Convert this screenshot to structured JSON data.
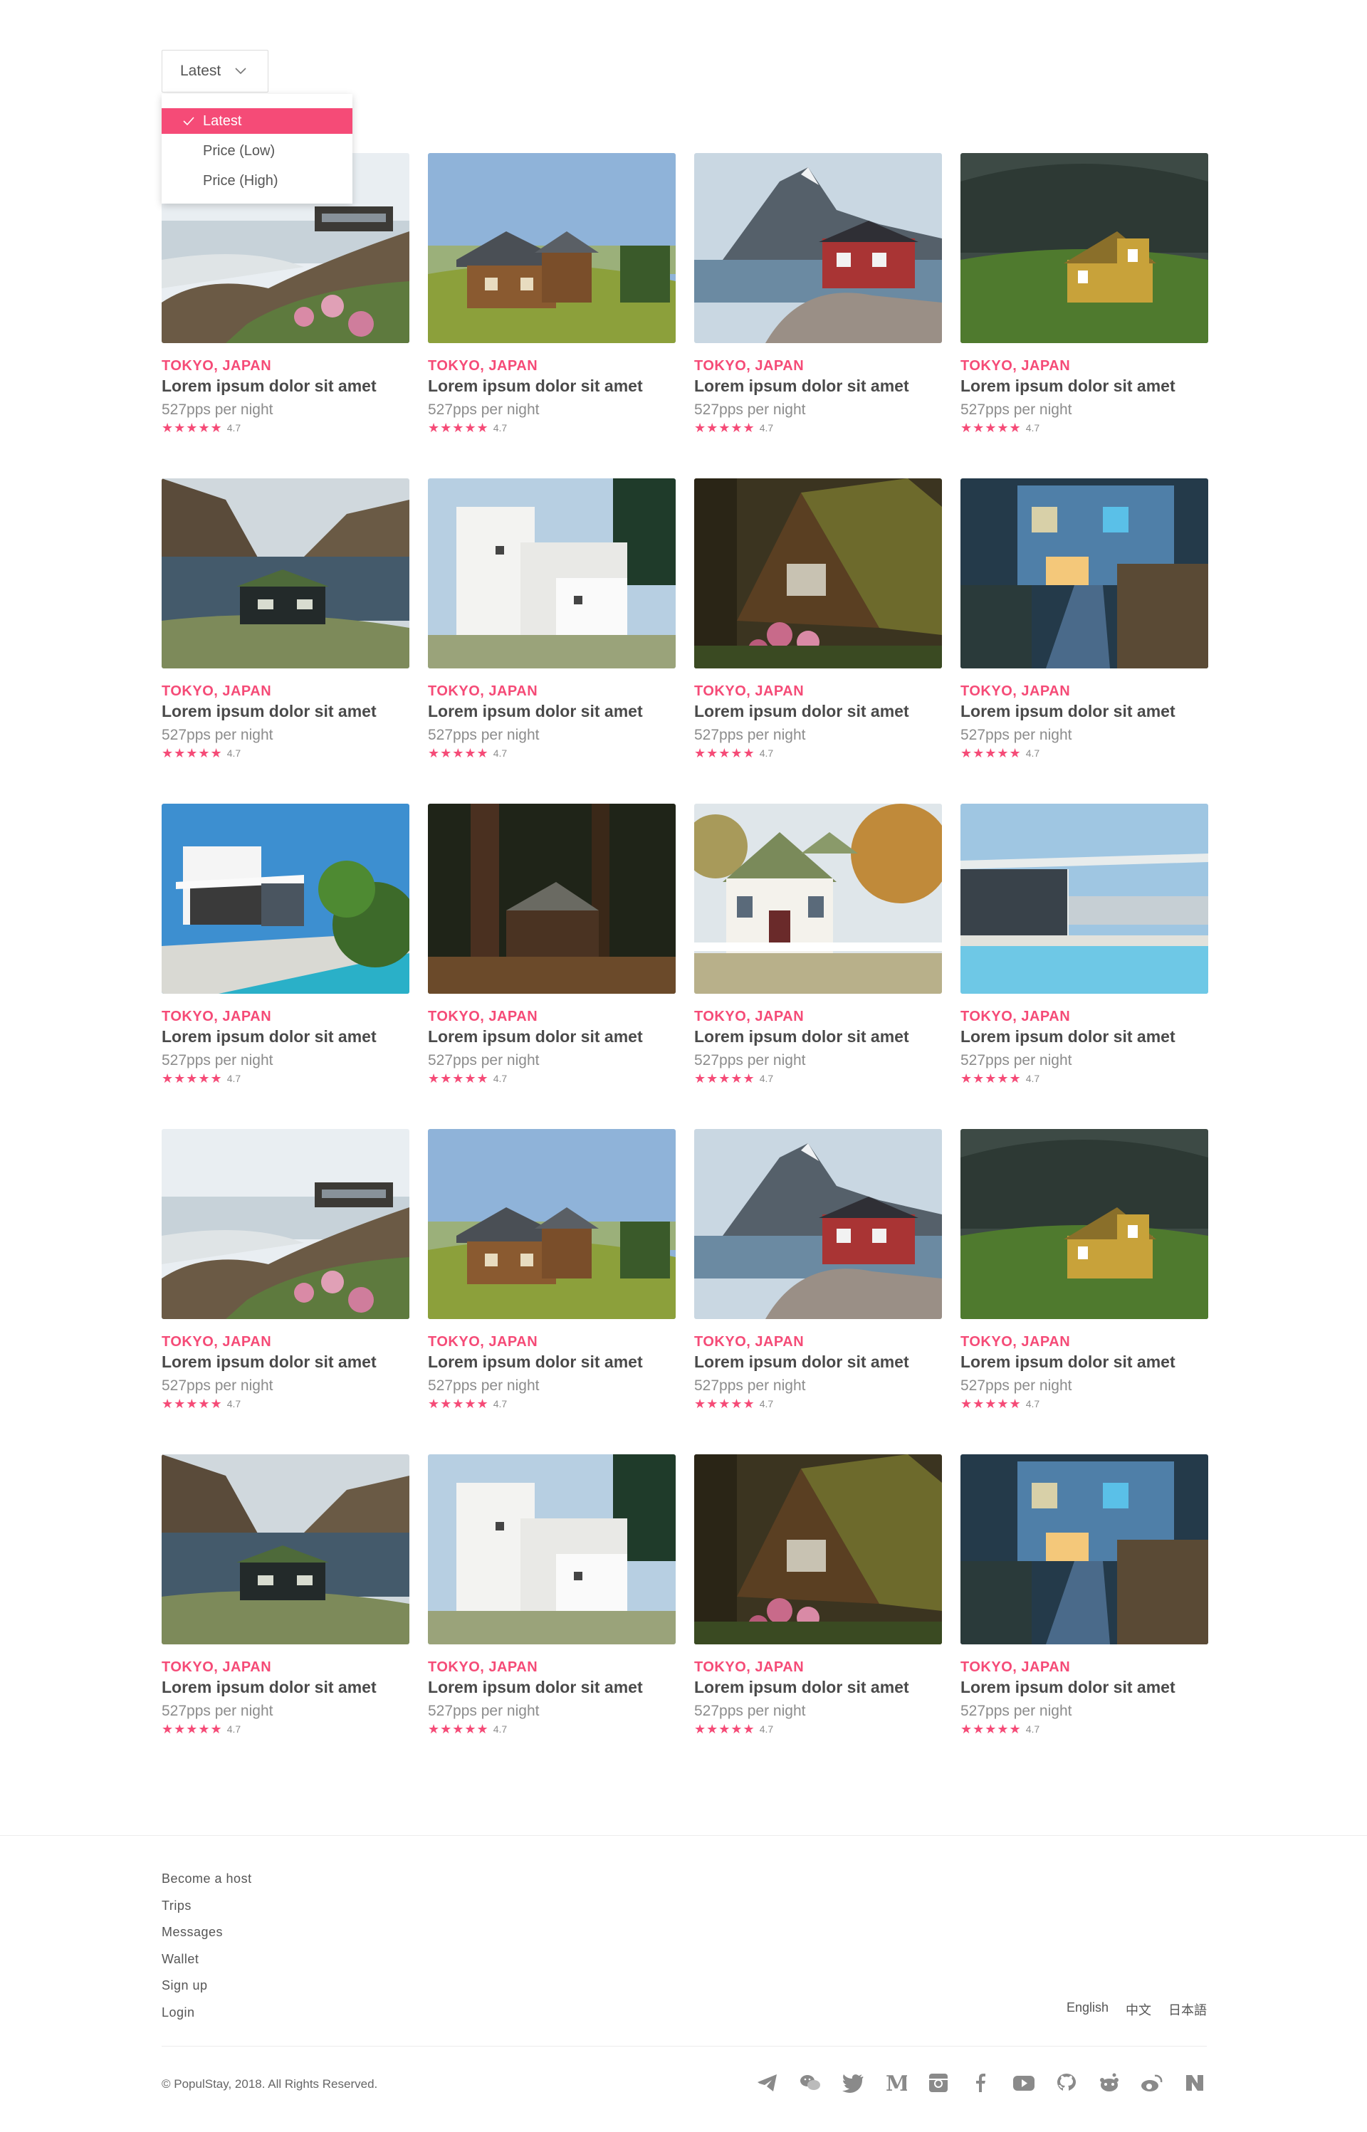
{
  "sort": {
    "current_label": "Latest",
    "options": [
      "Latest",
      "Price (Low)",
      "Price (High)"
    ],
    "selected_index": 0
  },
  "colors": {
    "accent": "#f54b77",
    "text": "#4a4a4a",
    "muted": "#8c8c8c"
  },
  "listings": [
    {
      "location": "TOKYO, JAPAN",
      "title": "Lorem ipsum dolor sit amet",
      "price": "527pps per night",
      "stars": "★★★★★",
      "rating": "4.7",
      "image": "coastal-house"
    },
    {
      "location": "TOKYO, JAPAN",
      "title": "Lorem ipsum dolor sit amet",
      "price": "527pps per night",
      "stars": "★★★★★",
      "rating": "4.7",
      "image": "wooden-chalet"
    },
    {
      "location": "TOKYO, JAPAN",
      "title": "Lorem ipsum dolor sit amet",
      "price": "527pps per night",
      "stars": "★★★★★",
      "rating": "4.7",
      "image": "red-cabin-fjord"
    },
    {
      "location": "TOKYO, JAPAN",
      "title": "Lorem ipsum dolor sit amet",
      "price": "527pps per night",
      "stars": "★★★★★",
      "rating": "4.7",
      "image": "yellow-house"
    },
    {
      "location": "TOKYO, JAPAN",
      "title": "Lorem ipsum dolor sit amet",
      "price": "527pps per night",
      "stars": "★★★★★",
      "rating": "4.7",
      "image": "lake-turf-house"
    },
    {
      "location": "TOKYO, JAPAN",
      "title": "Lorem ipsum dolor sit amet",
      "price": "527pps per night",
      "stars": "★★★★★",
      "rating": "4.7",
      "image": "white-modern-house"
    },
    {
      "location": "TOKYO, JAPAN",
      "title": "Lorem ipsum dolor sit amet",
      "price": "527pps per night",
      "stars": "★★★★★",
      "rating": "4.7",
      "image": "forest-a-frame"
    },
    {
      "location": "TOKYO, JAPAN",
      "title": "Lorem ipsum dolor sit amet",
      "price": "527pps per night",
      "stars": "★★★★★",
      "rating": "4.7",
      "image": "blue-house-night"
    },
    {
      "location": "TOKYO, JAPAN",
      "title": "Lorem ipsum dolor sit amet",
      "price": "527pps per night",
      "stars": "★★★★★",
      "rating": "4.7",
      "image": "modern-pool-villa"
    },
    {
      "location": "TOKYO, JAPAN",
      "title": "Lorem ipsum dolor sit amet",
      "price": "527pps per night",
      "stars": "★★★★★",
      "rating": "4.7",
      "image": "dark-woods-cabin"
    },
    {
      "location": "TOKYO, JAPAN",
      "title": "Lorem ipsum dolor sit amet",
      "price": "527pps per night",
      "stars": "★★★★★",
      "rating": "4.7",
      "image": "white-cottage"
    },
    {
      "location": "TOKYO, JAPAN",
      "title": "Lorem ipsum dolor sit amet",
      "price": "527pps per night",
      "stars": "★★★★★",
      "rating": "4.7",
      "image": "glass-house-pool"
    },
    {
      "location": "TOKYO, JAPAN",
      "title": "Lorem ipsum dolor sit amet",
      "price": "527pps per night",
      "stars": "★★★★★",
      "rating": "4.7",
      "image": "coastal-house"
    },
    {
      "location": "TOKYO, JAPAN",
      "title": "Lorem ipsum dolor sit amet",
      "price": "527pps per night",
      "stars": "★★★★★",
      "rating": "4.7",
      "image": "wooden-chalet"
    },
    {
      "location": "TOKYO, JAPAN",
      "title": "Lorem ipsum dolor sit amet",
      "price": "527pps per night",
      "stars": "★★★★★",
      "rating": "4.7",
      "image": "red-cabin-fjord"
    },
    {
      "location": "TOKYO, JAPAN",
      "title": "Lorem ipsum dolor sit amet",
      "price": "527pps per night",
      "stars": "★★★★★",
      "rating": "4.7",
      "image": "yellow-house"
    },
    {
      "location": "TOKYO, JAPAN",
      "title": "Lorem ipsum dolor sit amet",
      "price": "527pps per night",
      "stars": "★★★★★",
      "rating": "4.7",
      "image": "lake-turf-house"
    },
    {
      "location": "TOKYO, JAPAN",
      "title": "Lorem ipsum dolor sit amet",
      "price": "527pps per night",
      "stars": "★★★★★",
      "rating": "4.7",
      "image": "white-modern-house"
    },
    {
      "location": "TOKYO, JAPAN",
      "title": "Lorem ipsum dolor sit amet",
      "price": "527pps per night",
      "stars": "★★★★★",
      "rating": "4.7",
      "image": "forest-a-frame"
    },
    {
      "location": "TOKYO, JAPAN",
      "title": "Lorem ipsum dolor sit amet",
      "price": "527pps per night",
      "stars": "★★★★★",
      "rating": "4.7",
      "image": "blue-house-night"
    }
  ],
  "footer": {
    "links": [
      "Become a host",
      "Trips",
      "Messages",
      "Wallet",
      "Sign up",
      "Login"
    ],
    "languages": [
      "English",
      "中文",
      "日本語"
    ],
    "copyright": "© PopulStay, 2018. All Rights Reserved.",
    "social": [
      {
        "icon": "telegram-icon"
      },
      {
        "icon": "wechat-icon"
      },
      {
        "icon": "twitter-icon"
      },
      {
        "icon": "medium-icon"
      },
      {
        "icon": "instagram-icon"
      },
      {
        "icon": "facebook-icon"
      },
      {
        "icon": "youtube-icon"
      },
      {
        "icon": "github-icon"
      },
      {
        "icon": "reddit-icon"
      },
      {
        "icon": "weibo-icon"
      },
      {
        "icon": "naver-icon"
      }
    ]
  }
}
